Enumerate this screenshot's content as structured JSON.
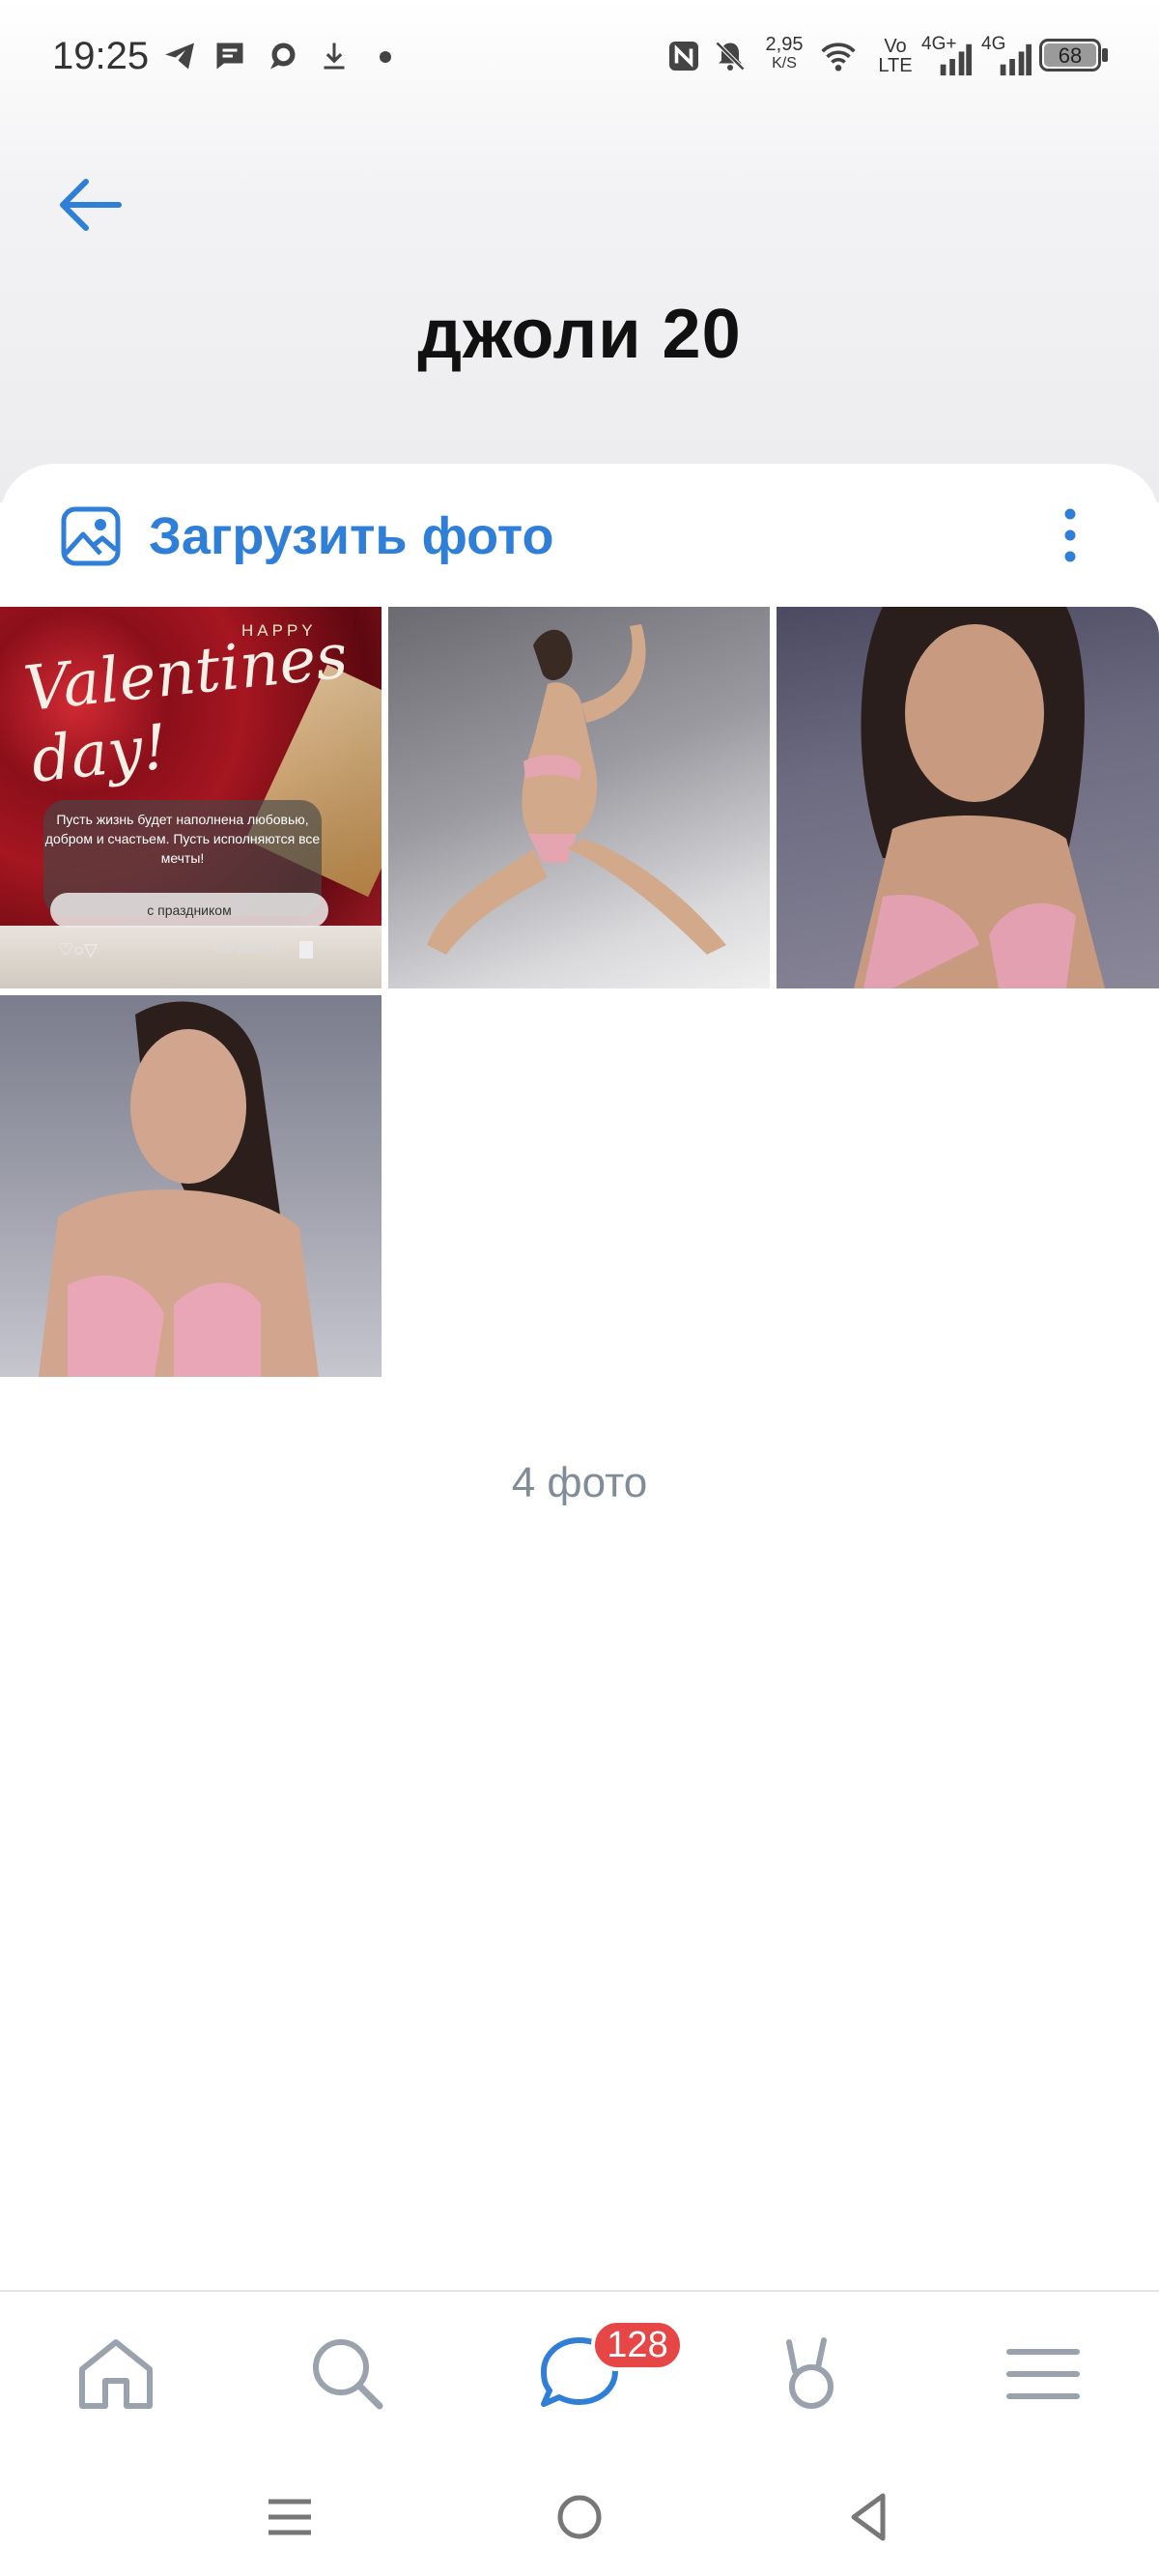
{
  "status_bar": {
    "time": "19:25",
    "net_speed_value": "2,95",
    "net_speed_unit": "K/S",
    "volte_top": "Vo",
    "volte_bottom": "LTE",
    "sim1": "4G+",
    "sim2": "4G",
    "battery": "68",
    "icons": [
      "telegram-icon",
      "message-icon",
      "chat-icon",
      "download-icon",
      "dot-icon",
      "nfc-icon",
      "bell-muted-icon",
      "wifi-icon",
      "signal-icon",
      "battery-icon"
    ]
  },
  "header": {
    "title": "джоли 20",
    "back_icon": "arrow-left-icon"
  },
  "toolbar": {
    "upload_label": "Загрузить фото",
    "upload_icon": "image-icon",
    "more_icon": "more-vertical-icon"
  },
  "photos": {
    "valentine": {
      "happy": "HAPPY",
      "script": "Valentines day!",
      "message": "Пусть жизнь будет наполнена любовью, добром и счастьем. Пусть исполняются все мечты!",
      "button": "с праздником",
      "save": "сохранить"
    }
  },
  "album": {
    "count_label": "4 фото"
  },
  "bottom_nav": {
    "items": [
      "home-icon",
      "search-icon",
      "messages-icon",
      "clips-icon",
      "menu-icon"
    ],
    "messages_badge": "128"
  },
  "colors": {
    "accent": "#2f7ed8",
    "badge": "#e64646",
    "muted_text": "#818c99",
    "nav_icon": "#99a2ad"
  }
}
